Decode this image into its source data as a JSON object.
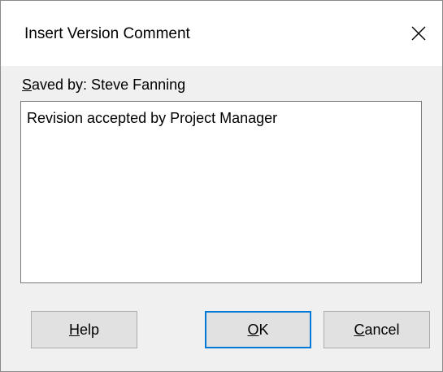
{
  "dialog": {
    "title": "Insert Version Comment",
    "close_glyph": "×"
  },
  "saved_by": {
    "mnemonic": "S",
    "rest": "aved by: Steve Fanning"
  },
  "comment": {
    "value": "Revision accepted by Project Manager"
  },
  "buttons": {
    "help": {
      "mnemonic": "H",
      "rest": "elp"
    },
    "ok": {
      "mnemonic": "O",
      "rest": "K"
    },
    "cancel": {
      "mnemonic": "C",
      "rest": "ancel"
    }
  },
  "colors": {
    "dialog_bg": "#f0f0f0",
    "titlebar_bg": "#ffffff",
    "button_bg": "#e1e1e1",
    "focus_border": "#0078d7"
  }
}
